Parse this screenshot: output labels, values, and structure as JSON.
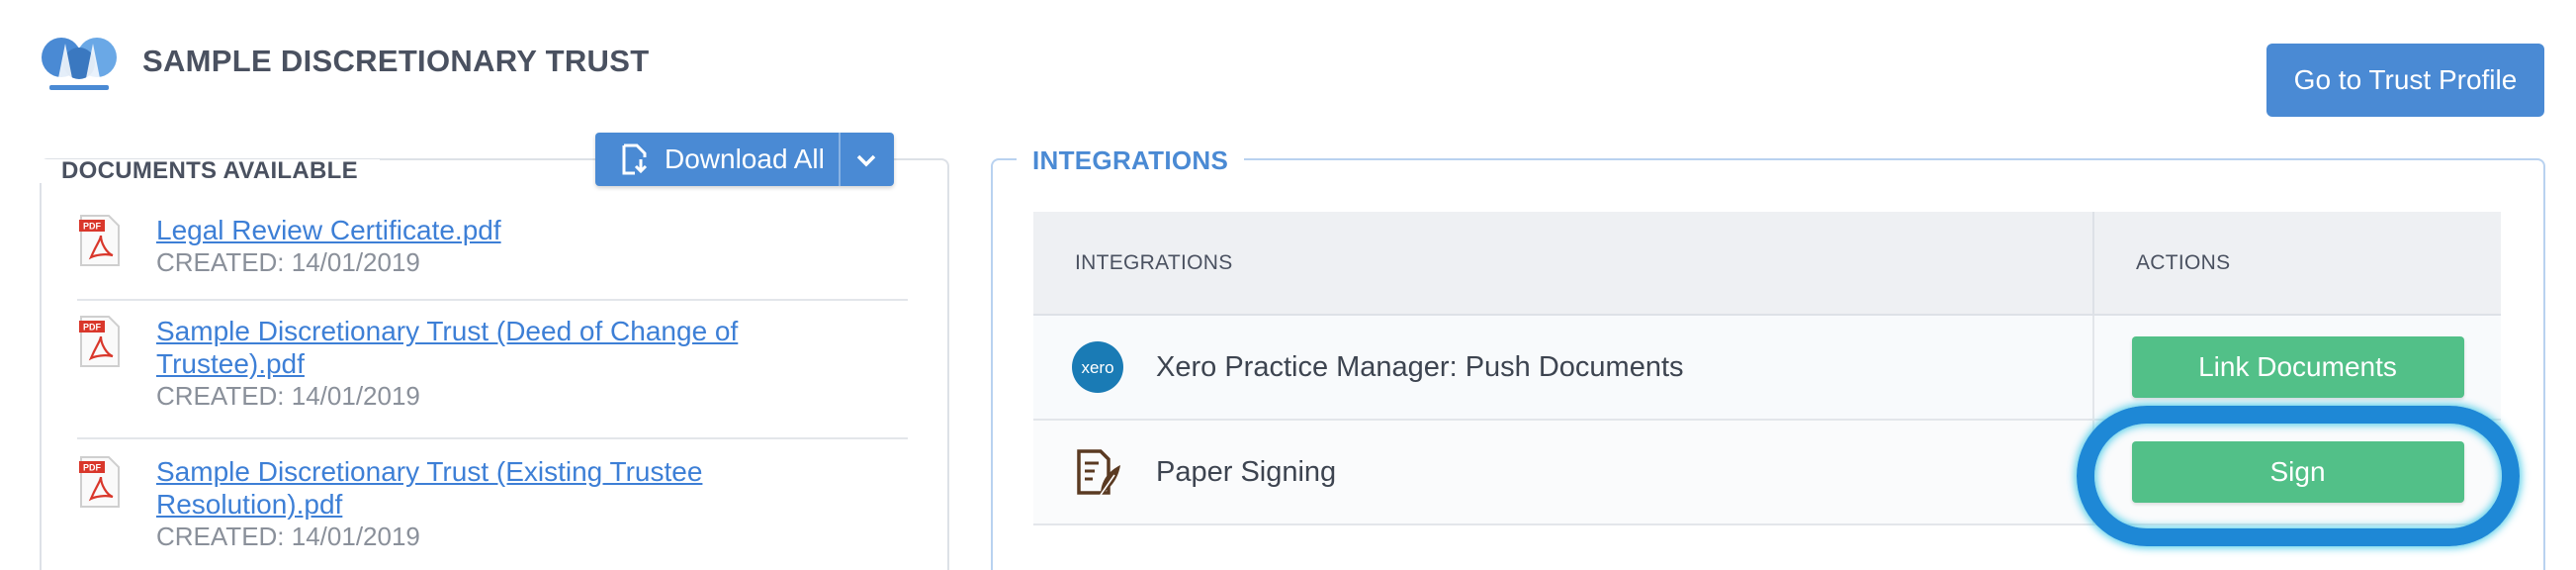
{
  "header": {
    "trust_name": "SAMPLE DISCRETIONARY TRUST",
    "profile_button": "Go to Trust Profile"
  },
  "documents": {
    "legend": "DOCUMENTS AVAILABLE",
    "download_all": "Download All",
    "items": [
      {
        "name": "Legal Review Certificate.pdf",
        "created": "CREATED: 14/01/2019"
      },
      {
        "name": "Sample Discretionary Trust (Deed of Change of Trustee).pdf",
        "created": "CREATED: 14/01/2019"
      },
      {
        "name": "Sample Discretionary Trust (Existing Trustee Resolution).pdf",
        "created": "CREATED: 14/01/2019"
      }
    ]
  },
  "integrations": {
    "legend": "INTEGRATIONS",
    "columns": [
      "INTEGRATIONS",
      "ACTIONS"
    ],
    "rows": [
      {
        "name": "Xero Practice Manager: Push Documents",
        "action": "Link Documents",
        "icon": "xero-logo-icon"
      },
      {
        "name": "Paper Signing",
        "action": "Sign",
        "icon": "paper-signing-icon"
      }
    ]
  },
  "colors": {
    "primary_blue": "#4a8ad4",
    "action_green": "#52c088",
    "highlight_ring": "#1e88d6",
    "xero_blue": "#1a7bb5",
    "signing_brown": "#5a3a22"
  }
}
